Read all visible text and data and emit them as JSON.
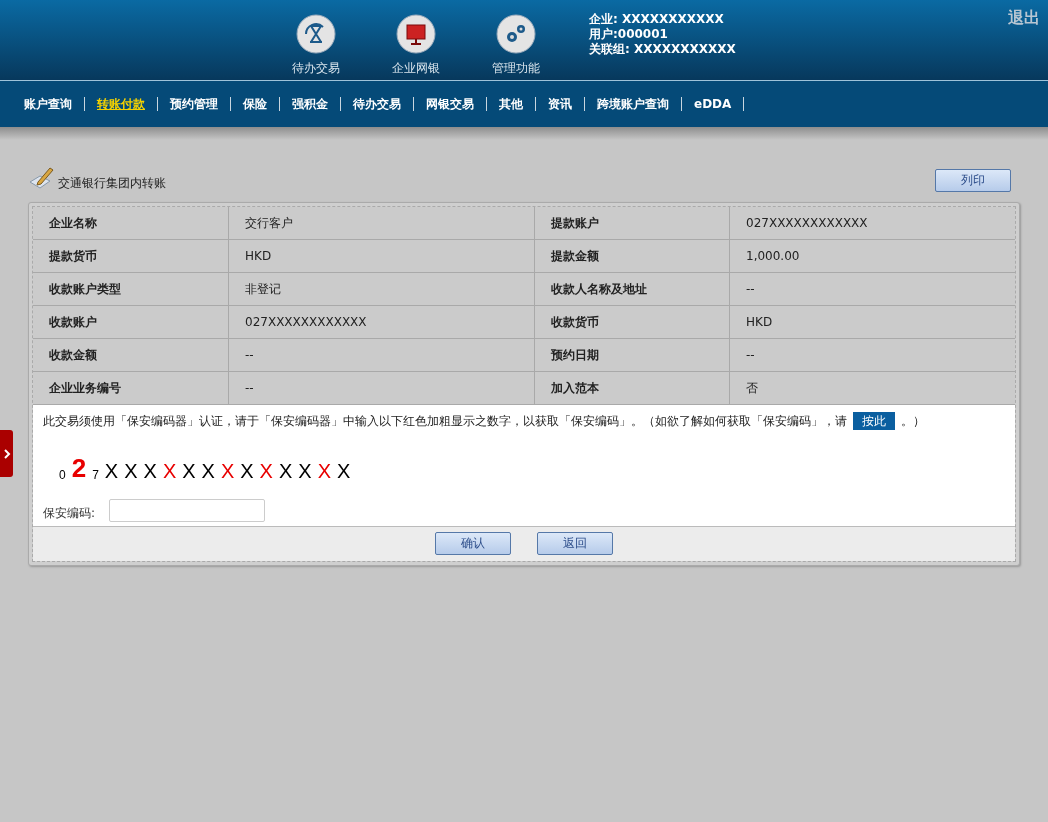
{
  "header": {
    "shortcuts": [
      {
        "label": "待办交易"
      },
      {
        "label": "企业网银"
      },
      {
        "label": "管理功能"
      }
    ],
    "user_info": [
      "企业: XXXXXXXXXXX",
      "用户:000001",
      "关联组: XXXXXXXXXXX"
    ],
    "logout": "退出"
  },
  "nav": [
    {
      "label": "账户查询",
      "selected": false
    },
    {
      "label": "转账付款",
      "selected": true
    },
    {
      "label": "预约管理",
      "selected": false
    },
    {
      "label": "保险",
      "selected": false
    },
    {
      "label": "强积金",
      "selected": false
    },
    {
      "label": "待办交易",
      "selected": false
    },
    {
      "label": "网银交易",
      "selected": false
    },
    {
      "label": "其他",
      "selected": false
    },
    {
      "label": "资讯",
      "selected": false
    },
    {
      "label": "跨境账户查询",
      "selected": false
    },
    {
      "label": "eDDA",
      "selected": false
    }
  ],
  "page_title": "交通银行集团内转账",
  "print_button": "列印",
  "table": {
    "rows": [
      [
        "企业名称",
        "交行客户",
        "提款账户",
        "027XXXXXXXXXXXX"
      ],
      [
        "提款货币",
        "HKD",
        "提款金额",
        "1,000.00"
      ],
      [
        "收款账户类型",
        "非登记",
        "收款人名称及地址",
        "--"
      ],
      [
        "收款账户",
        "027XXXXXXXXXXXX",
        "收款货币",
        "HKD"
      ],
      [
        "收款金额",
        "--",
        "预约日期",
        "--"
      ],
      [
        "企业业务编号",
        "--",
        "加入范本",
        "否"
      ]
    ]
  },
  "security": {
    "instruction_before": "此交易须使用「保安编码器」认证，请于「保安编码器」中输入以下红色加粗显示之数字，以获取「保安编码」。（如欲了解如何获取「保安编码」，请",
    "link": "按此",
    "instruction_after": "。）",
    "code_prefix": [
      {
        "char": "0",
        "highlight": false
      },
      {
        "char": "2",
        "highlight": true
      },
      {
        "char": "7",
        "highlight": false
      }
    ],
    "code": [
      {
        "char": "X",
        "highlight": false
      },
      {
        "char": "X",
        "highlight": false
      },
      {
        "char": "X",
        "highlight": false
      },
      {
        "char": "X",
        "highlight": true
      },
      {
        "char": "X",
        "highlight": false
      },
      {
        "char": "X",
        "highlight": false
      },
      {
        "char": "X",
        "highlight": true
      },
      {
        "char": "X",
        "highlight": false
      },
      {
        "char": "X",
        "highlight": true
      },
      {
        "char": "X",
        "highlight": false
      },
      {
        "char": "X",
        "highlight": false
      },
      {
        "char": "X",
        "highlight": true
      },
      {
        "char": "X",
        "highlight": false
      }
    ],
    "field_label": "保安编码:"
  },
  "buttons": [
    "确认",
    "返回"
  ]
}
